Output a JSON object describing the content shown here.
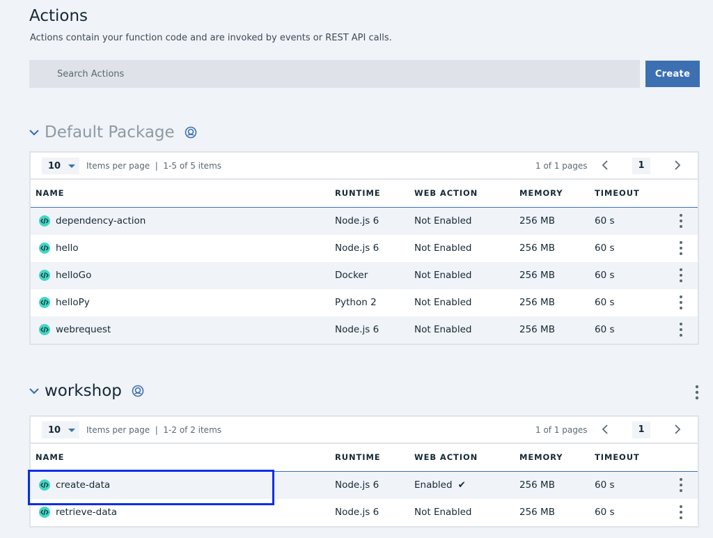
{
  "header": {
    "title": "Actions",
    "subtitle": "Actions contain your function code and are invoked by events or REST API calls."
  },
  "search": {
    "placeholder": "Search Actions"
  },
  "create_label": "Create",
  "packages": [
    {
      "name": "Default Package",
      "pager": {
        "items_per_page": "10",
        "ipp_label": "Items per page  |  1-5 of 5 items",
        "pages_text": "1 of 1 pages",
        "current_page": "1"
      },
      "columns": [
        "NAME",
        "RUNTIME",
        "WEB ACTION",
        "MEMORY",
        "TIMEOUT"
      ],
      "rows": [
        {
          "name": "dependency-action",
          "runtime": "Node.js 6",
          "web": "Not Enabled",
          "memory": "256 MB",
          "timeout": "60 s"
        },
        {
          "name": "hello",
          "runtime": "Node.js 6",
          "web": "Not Enabled",
          "memory": "256 MB",
          "timeout": "60 s"
        },
        {
          "name": "helloGo",
          "runtime": "Docker",
          "web": "Not Enabled",
          "memory": "256 MB",
          "timeout": "60 s"
        },
        {
          "name": "helloPy",
          "runtime": "Python 2",
          "web": "Not Enabled",
          "memory": "256 MB",
          "timeout": "60 s"
        },
        {
          "name": "webrequest",
          "runtime": "Node.js 6",
          "web": "Not Enabled",
          "memory": "256 MB",
          "timeout": "60 s"
        }
      ]
    },
    {
      "name": "workshop",
      "pager": {
        "items_per_page": "10",
        "ipp_label": "Items per page  |  1-2 of 2 items",
        "pages_text": "1 of 1 pages",
        "current_page": "1"
      },
      "columns": [
        "NAME",
        "RUNTIME",
        "WEB ACTION",
        "MEMORY",
        "TIMEOUT"
      ],
      "rows": [
        {
          "name": "create-data",
          "runtime": "Node.js 6",
          "web": "Enabled",
          "web_check": "✔",
          "memory": "256 MB",
          "timeout": "60 s"
        },
        {
          "name": "retrieve-data",
          "runtime": "Node.js 6",
          "web": "Not Enabled",
          "memory": "256 MB",
          "timeout": "60 s"
        }
      ]
    }
  ],
  "colors": {
    "accent": "#3d70b2",
    "function_icon": "#41d6c3",
    "highlight": "#0a2ee6"
  },
  "icons": {
    "package": "package-icon",
    "function": "code-icon",
    "collapse": "chevron-down-icon",
    "overflow": "overflow-menu-icon"
  }
}
